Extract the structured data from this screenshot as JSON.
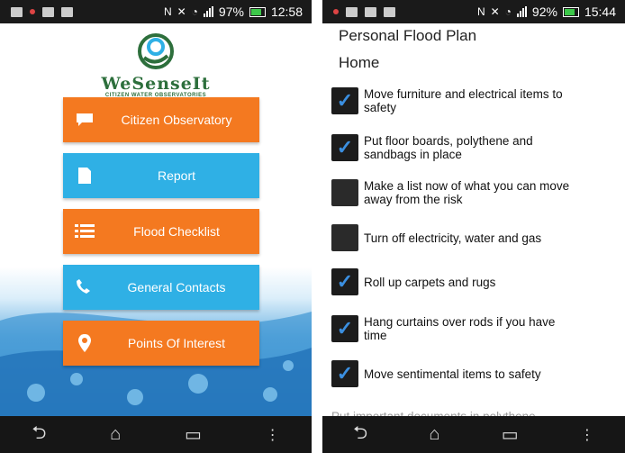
{
  "left": {
    "status": {
      "time": "12:58",
      "battery": "97%"
    },
    "logo": {
      "title": "WeSenseIt",
      "subtitle": "CITIZEN WATER OBSERVATORIES"
    },
    "buttons": [
      {
        "label": "Citizen Observatory",
        "icon": "chat-bubble-icon",
        "color": "#f47920"
      },
      {
        "label": "Report",
        "icon": "document-icon",
        "color": "#2fb0e5"
      },
      {
        "label": "Flood Checklist",
        "icon": "list-icon",
        "color": "#f47920"
      },
      {
        "label": "General Contacts",
        "icon": "phone-icon",
        "color": "#2fb0e5"
      },
      {
        "label": "Points Of Interest",
        "icon": "location-pin-icon",
        "color": "#f47920"
      }
    ]
  },
  "right": {
    "status": {
      "time": "15:44",
      "battery": "92%"
    },
    "title": "Personal Flood Plan",
    "section": "Home",
    "items": [
      {
        "line1": "Move furniture and electrical items to",
        "line2": "safety",
        "checked": true
      },
      {
        "line1": "Put floor boards, polythene and",
        "line2": "sandbags in place",
        "checked": true
      },
      {
        "line1": "Make a list now of what you can move",
        "line2": "away from the risk",
        "checked": false
      },
      {
        "line1": "Turn off electricity, water and gas",
        "line2": "",
        "checked": false
      },
      {
        "line1": "Roll up carpets and rugs",
        "line2": "",
        "checked": true
      },
      {
        "line1": "Hang curtains over rods if you have",
        "line2": "time",
        "checked": true
      },
      {
        "line1": "Move sentimental items to safety",
        "line2": "",
        "checked": true
      }
    ],
    "partial_item": "Put important documents in polythene"
  },
  "nav_icons": [
    "back-icon",
    "home-icon",
    "recent-apps-icon",
    "menu-icon"
  ]
}
